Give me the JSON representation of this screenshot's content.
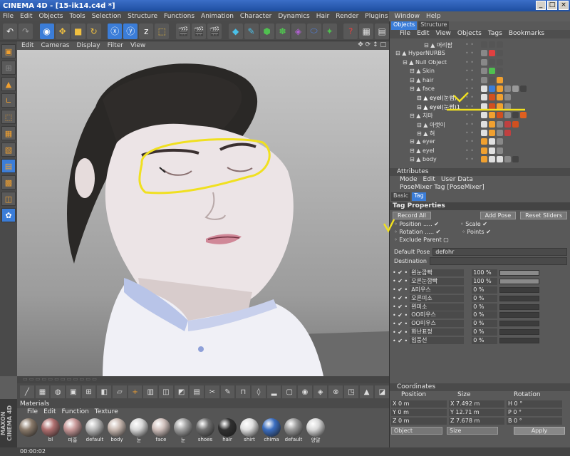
{
  "window": {
    "title": "CINEMA 4D - [15-ik14.c4d *]",
    "buttons": [
      "_",
      "□",
      "×"
    ]
  },
  "menu": [
    "File",
    "Edit",
    "Objects",
    "Tools",
    "Selection",
    "Structure",
    "Functions",
    "Animation",
    "Character",
    "Dynamics",
    "Hair",
    "Render",
    "Plugins",
    "Window",
    "Help"
  ],
  "viewport": {
    "menu": [
      "Edit",
      "Cameras",
      "Display",
      "Filter",
      "View"
    ]
  },
  "object_manager": {
    "tabs": [
      "Objects",
      "Structure"
    ],
    "menu": [
      "File",
      "Edit",
      "View",
      "Objects",
      "Tags",
      "Bookmarks"
    ],
    "items": [
      {
        "name": "머리팝",
        "indent": 4
      },
      {
        "name": "HyperNURBS",
        "indent": 0
      },
      {
        "name": "Null Object",
        "indent": 1
      },
      {
        "name": "Skin",
        "indent": 2
      },
      {
        "name": "hair",
        "indent": 2
      },
      {
        "name": "face",
        "indent": 2
      },
      {
        "name": "eyel(눈썹)",
        "indent": 3
      },
      {
        "name": "eyel(눈썹)1",
        "indent": 3
      },
      {
        "name": "치마",
        "indent": 2
      },
      {
        "name": "아랫이",
        "indent": 3
      },
      {
        "name": "혀",
        "indent": 3
      },
      {
        "name": "eyer",
        "indent": 2
      },
      {
        "name": "eyel",
        "indent": 2
      },
      {
        "name": "body",
        "indent": 2
      }
    ]
  },
  "attributes": {
    "header": "Attributes",
    "menu": [
      "Mode",
      "Edit",
      "User Data"
    ],
    "tag_title": "PoseMixer Tag [PoseMixer]",
    "tabs": [
      "Basic",
      "Tag"
    ],
    "section": "Tag Properties",
    "buttons": {
      "record": "Record All",
      "add_pose": "Add Pose",
      "reset": "Reset Sliders"
    },
    "checks": {
      "position": "Position",
      "rotation": "Rotation",
      "scale": "Scale",
      "points": "Points",
      "exclude": "Exclude Parent"
    },
    "default_pose_label": "Default Pose",
    "default_pose_value": "defohr",
    "destination_label": "Destination",
    "sliders": [
      {
        "label": "왼눈깜빡",
        "value": "100 %",
        "level": 1.0
      },
      {
        "label": "오른눈깜빡",
        "value": "100 %",
        "level": 1.0
      },
      {
        "label": "A미우스",
        "value": "0 %",
        "level": 0
      },
      {
        "label": "오른미소",
        "value": "0 %",
        "level": 0
      },
      {
        "label": "왼미소",
        "value": "0 %",
        "level": 0
      },
      {
        "label": "OO미우스",
        "value": "0 %",
        "level": 0
      },
      {
        "label": "OO미우스",
        "value": "0 %",
        "level": 0
      },
      {
        "label": "화난표정",
        "value": "0 %",
        "level": 0
      },
      {
        "label": "입풍선",
        "value": "0 %",
        "level": 0
      }
    ]
  },
  "coordinates": {
    "header": "Coordinates",
    "cols": [
      "Position",
      "Size",
      "Rotation"
    ],
    "rows": [
      {
        "axis": "X",
        "pos": "0 m",
        "size_axis": "X",
        "size": "7.492 m",
        "rot_axis": "H",
        "rot": "0 °"
      },
      {
        "axis": "Y",
        "pos": "0 m",
        "size_axis": "Y",
        "size": "12.71 m",
        "rot_axis": "P",
        "rot": "0 °"
      },
      {
        "axis": "Z",
        "pos": "0 m",
        "size_axis": "Z",
        "size": "7.678 m",
        "rot_axis": "B",
        "rot": "0 °"
      }
    ],
    "mode1": "Object",
    "mode2": "Size",
    "apply": "Apply"
  },
  "materials": {
    "header": "Materials",
    "menu": [
      "File",
      "Edit",
      "Function",
      "Texture"
    ],
    "items": [
      {
        "name": "",
        "color": "#8a7a6a"
      },
      {
        "name": "bl",
        "color": "#b07070"
      },
      {
        "name": "미홍",
        "color": "#c89898"
      },
      {
        "name": "default",
        "color": "#b8b8b8"
      },
      {
        "name": "body",
        "color": "#c8b8b0"
      },
      {
        "name": "눈",
        "color": "#d8d8d8"
      },
      {
        "name": "face",
        "color": "#d0c0bc"
      },
      {
        "name": "눈",
        "color": "#a0a0a0"
      },
      {
        "name": "shoes",
        "color": "#707070"
      },
      {
        "name": "hair",
        "color": "#303030"
      },
      {
        "name": "shirt",
        "color": "#e0e0e0"
      },
      {
        "name": "chima",
        "color": "#3b6ec0"
      },
      {
        "name": "default",
        "color": "#9a9a9a"
      },
      {
        "name": "양말",
        "color": "#d8d8d8"
      }
    ]
  },
  "status": {
    "time": "00:00:02"
  },
  "logo": "MAXON CINEMA 4D"
}
